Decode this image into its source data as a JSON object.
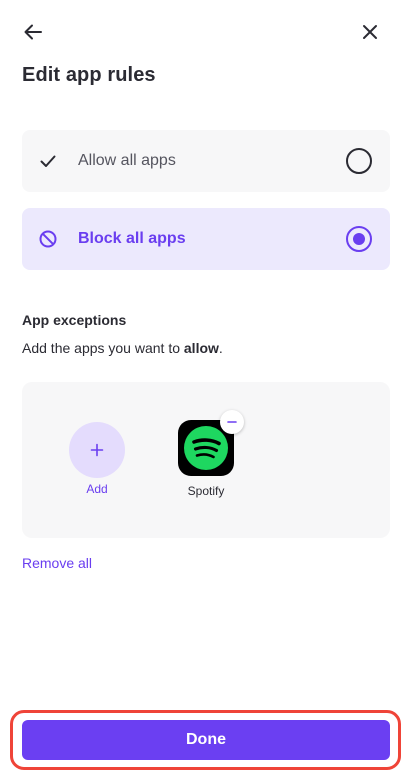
{
  "header": {
    "back_icon": "arrow-left-icon",
    "close_icon": "close-icon",
    "title": "Edit app rules"
  },
  "options": [
    {
      "label": "Allow all apps",
      "icon": "check-icon",
      "selected": false
    },
    {
      "label": "Block all apps",
      "icon": "block-icon",
      "selected": true
    }
  ],
  "exceptions": {
    "title": "App exceptions",
    "description_prefix": "Add the apps you want to ",
    "description_emphasis": "allow",
    "description_suffix": ".",
    "add_label": "Add",
    "apps": [
      {
        "name": "Spotify",
        "icon": "spotify-icon"
      }
    ],
    "remove_all_label": "Remove all"
  },
  "footer": {
    "done_label": "Done"
  },
  "colors": {
    "accent": "#6a3ef0",
    "selected_bg": "#ece9fd",
    "highlight_outline": "#ef4438"
  }
}
